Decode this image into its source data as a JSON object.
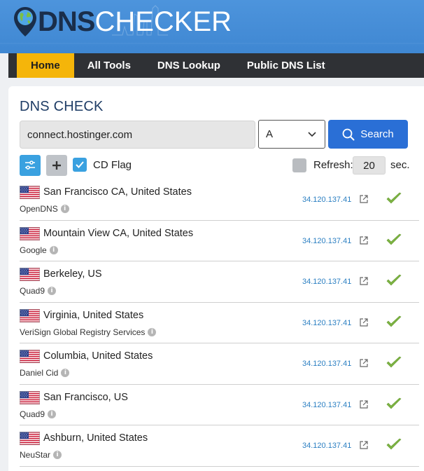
{
  "brand": {
    "logo_dns": "DNS",
    "logo_checker": "CHECKER"
  },
  "nav": [
    {
      "label": "Home",
      "active": true
    },
    {
      "label": "All Tools"
    },
    {
      "label": "DNS Lookup"
    },
    {
      "label": "Public DNS List"
    }
  ],
  "check": {
    "title": "DNS CHECK",
    "domain_value": "connect.hostinger.com",
    "record_type": "A",
    "search_label": "Search",
    "cd_flag_label": "CD Flag",
    "cd_flag_checked": true,
    "refresh_label": "Refresh:",
    "refresh_value": "20",
    "refresh_unit": "sec.",
    "refresh_checked": false
  },
  "results": [
    {
      "location": "San Francisco CA, United States",
      "provider": "OpenDNS",
      "ip": "34.120.137.41",
      "status": "ok",
      "flag": "us-flag-icon"
    },
    {
      "location": "Mountain View CA, United States",
      "provider": "Google",
      "ip": "34.120.137.41",
      "status": "ok",
      "flag": "us-flag-icon"
    },
    {
      "location": "Berkeley, US",
      "provider": "Quad9",
      "ip": "34.120.137.41",
      "status": "ok",
      "flag": "us-flag-icon"
    },
    {
      "location": "Virginia, United States",
      "provider": "VeriSign Global Registry Services",
      "ip": "34.120.137.41",
      "status": "ok",
      "flag": "us-flag-icon"
    },
    {
      "location": "Columbia, United States",
      "provider": "Daniel Cid",
      "ip": "34.120.137.41",
      "status": "ok",
      "flag": "us-flag-icon"
    },
    {
      "location": "San Francisco, US",
      "provider": "Quad9",
      "ip": "34.120.137.41",
      "status": "ok",
      "flag": "us-flag-icon"
    },
    {
      "location": "Ashburn, United States",
      "provider": "NeuStar",
      "ip": "34.120.137.41",
      "status": "ok",
      "flag": "us-flag-icon"
    }
  ],
  "colors": {
    "header_blue": "#4a90d9",
    "nav_dark": "#2f3135",
    "nav_active": "#f5b50a",
    "accent_blue": "#2a6fd6",
    "check_green": "#7cb342"
  }
}
